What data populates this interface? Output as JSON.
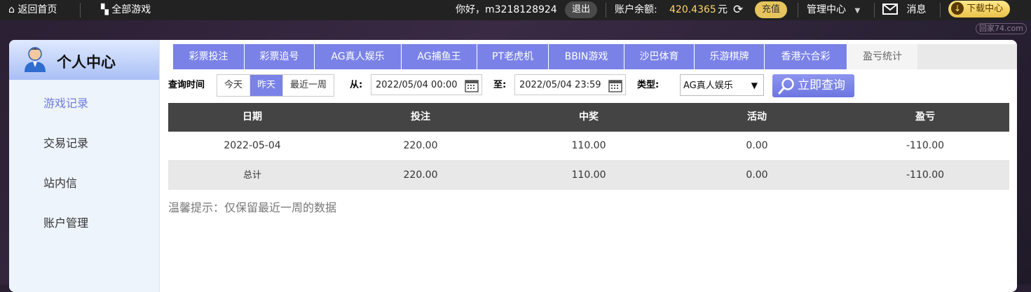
{
  "topbar": {
    "home_label": "返回首页",
    "games_label": "全部游戏",
    "greeting": "你好，m3218128924",
    "logout_label": "退出",
    "balance_label": "账户余额:",
    "balance_value": "420.4365",
    "currency": "元",
    "recharge_label": "充值",
    "manage_label": "管理中心",
    "message_label": "消息",
    "download_label": "下载中心",
    "watermark": "回家74.com"
  },
  "sidebar": {
    "title": "个人中心",
    "items": [
      {
        "label": "游戏记录"
      },
      {
        "label": "交易记录"
      },
      {
        "label": "站内信"
      },
      {
        "label": "账户管理"
      }
    ]
  },
  "tabs": [
    {
      "label": "彩票投注"
    },
    {
      "label": "彩票追号"
    },
    {
      "label": "AG真人娱乐"
    },
    {
      "label": "AG捕鱼王"
    },
    {
      "label": "PT老虎机"
    },
    {
      "label": "BBIN游戏"
    },
    {
      "label": "沙巴体育"
    },
    {
      "label": "乐游棋牌"
    },
    {
      "label": "香港六合彩"
    },
    {
      "label": "盈亏统计"
    }
  ],
  "filter": {
    "time_label": "查询时间",
    "quick_ranges": [
      "今天",
      "昨天",
      "最近一周"
    ],
    "selected_range": "昨天",
    "from_label": "从:",
    "from_value": "2022/05/04 00:00",
    "to_label": "至:",
    "to_value": "2022/05/04 23:59",
    "type_label": "类型:",
    "type_value": "AG真人娱乐",
    "query_label": "立即查询"
  },
  "table": {
    "headers": [
      "日期",
      "投注",
      "中奖",
      "活动",
      "盈亏"
    ],
    "rows": [
      [
        "2022-05-04",
        "220.00",
        "110.00",
        "0.00",
        "-110.00"
      ],
      [
        "总计",
        "220.00",
        "110.00",
        "0.00",
        "-110.00"
      ]
    ]
  },
  "tip": "温馨提示：仅保留最近一周的数据",
  "colors": {
    "accent": "#7a82e8",
    "topbar": "#222222",
    "balance": "#ffd56a",
    "table_header": "#444444"
  }
}
